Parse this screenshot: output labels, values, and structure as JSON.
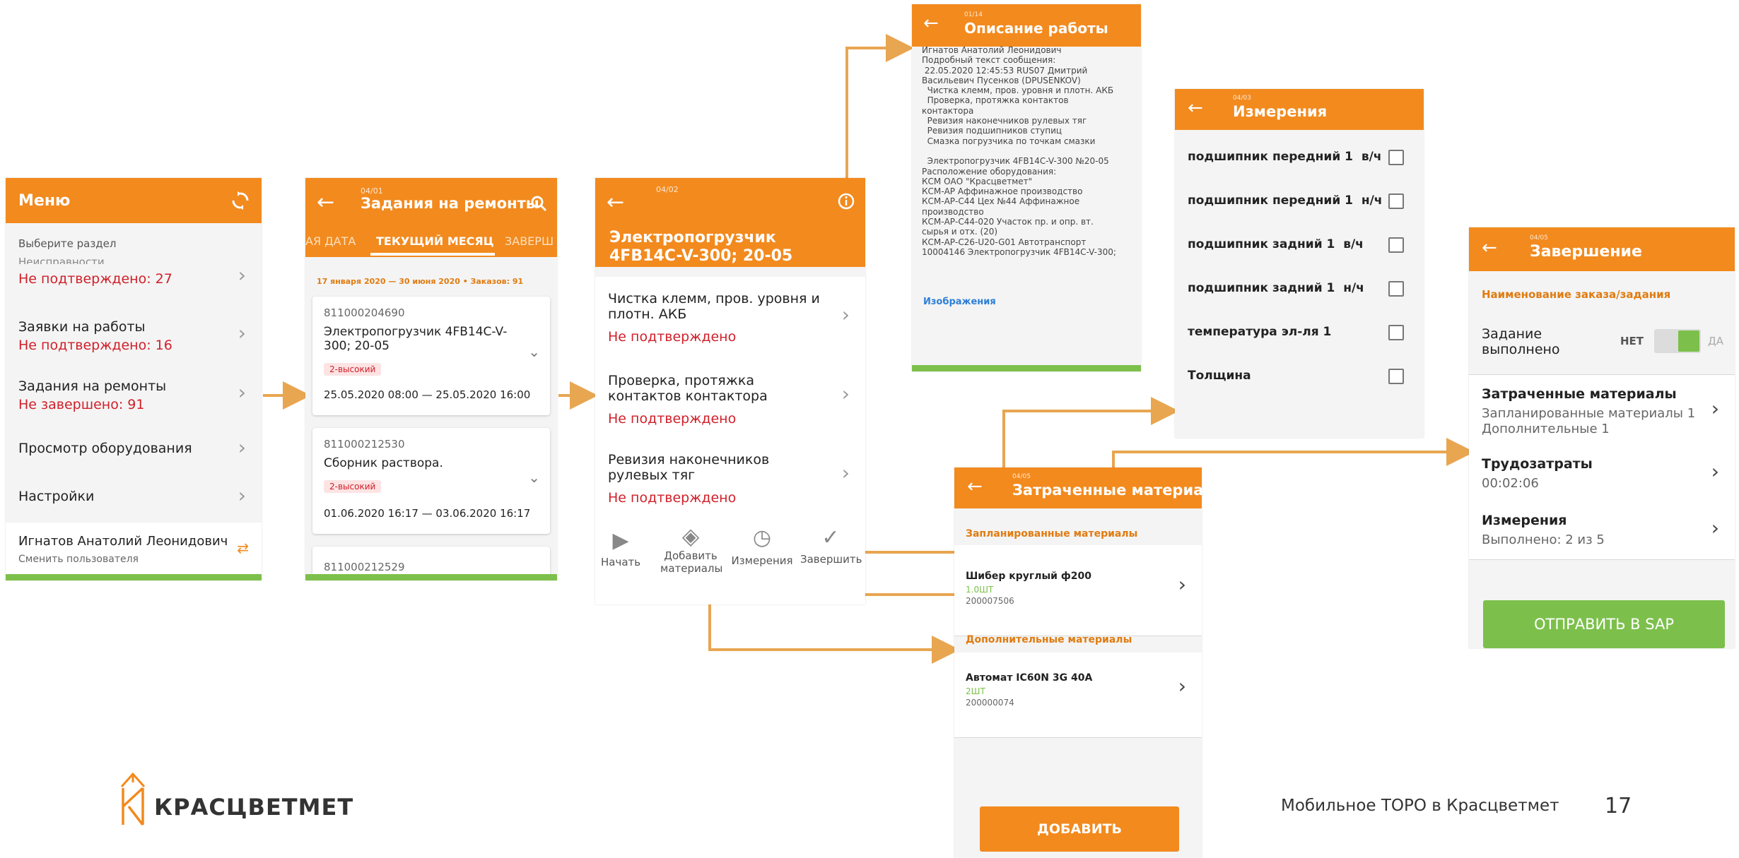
{
  "menu": {
    "title": "Меню",
    "section_label": "Выберите раздел",
    "items": [
      {
        "label": "Неисправности",
        "status": "Не подтверждено: 27"
      },
      {
        "label": "Заявки на работы",
        "status": "Не подтверждено: 16"
      },
      {
        "label": "Задания на ремонты",
        "status": "Не завершено: 91"
      },
      {
        "label": "Просмотр оборудования",
        "status": ""
      },
      {
        "label": "Настройки",
        "status": ""
      }
    ],
    "user_name": "Игнатов Анатолий Леонидович",
    "user_action": "Сменить пользователя"
  },
  "tasks": {
    "step": "04/01",
    "title": "Задания на ремонты",
    "tabs": [
      "АЯ ДАТА",
      "ТЕКУЩИЙ МЕСЯЦ",
      "ЗАВЕРШ"
    ],
    "range": "17 января 2020 — 30 июня 2020 • Заказов: 91",
    "cards": [
      {
        "id": "811000204690",
        "name": "Электропогрузчик 4FB14C-V-300; 20-05",
        "priority": "2-высокий",
        "dates": "25.05.2020 08:00 — 25.05.2020 16:00"
      },
      {
        "id": "811000212530",
        "name": "Сборник раствора.",
        "priority": "2-высокий",
        "dates": "01.06.2020 16:17 — 03.06.2020 16:17"
      },
      {
        "id": "811000212529",
        "name": "",
        "priority": "",
        "dates": ""
      }
    ]
  },
  "equipment": {
    "step": "04/02",
    "title": "Электропогрузчик 4FB14C-V-300; 20-05",
    "ops": [
      {
        "name": "Чистка клемм, пров. уровня и плотн. АКБ",
        "status": "Не подтверждено"
      },
      {
        "name": "Проверка, протяжка контактов контактора",
        "status": "Не подтверждено"
      },
      {
        "name": "Ревизия наконечников рулевых тяг",
        "status": "Не подтверждено"
      }
    ],
    "actions": [
      "Начать",
      "Добавить материалы",
      "Измерения",
      "Завершить"
    ]
  },
  "description": {
    "step": "01/14",
    "title": "Описание работы",
    "lines": [
      "Игнатов Анатолий Леонидович",
      "Подробный текст сообщения:",
      " 22.05.2020 12:45:53 RUS07 Дмитрий",
      "Васильевич Пусенков (DPUSENKOV)",
      "  Чистка клемм, пров. уровня и плотн. АКБ",
      "  Проверка, протяжка контактов",
      "контактора",
      "  Ревизия наконечников рулевых тяг",
      "  Ревизия подшипников ступиц",
      "  Смазка погрузчика по точкам смазки",
      "",
      "  Электропогрузчик 4FB14C-V-300 №20-05",
      "Расположение оборудования:",
      "КСМ ОАО \"Красцветмет\"",
      "КСМ-АР Аффинажное производство",
      "КСМ-АР-С44 Цех №44 Аффинажное",
      "производство",
      "КСМ-АР-С44-020 Участок пр. и опр. вт.",
      "сырья и отх. (20)",
      "КСМ-АР-С26-U20-G01 Автотранспорт",
      "10004146 Электропогрузчик 4FB14C-V-300;"
    ],
    "link": "Изображения"
  },
  "measurements": {
    "step": "04/03",
    "title": "Измерения",
    "items": [
      "подшипник передний 1  в/ч",
      "подшипник передний 1  н/ч",
      "подшипник задний 1  в/ч",
      "подшипник задний 1  н/ч",
      "температура эл-ля 1",
      "Толщина"
    ]
  },
  "materials": {
    "step": "04/05",
    "title": "Затраченные материалы",
    "planned_header": "Запланированные материалы",
    "planned": [
      {
        "name": "Шибер круглый ф200",
        "qty": "1.0ШТ",
        "code": "200007506"
      }
    ],
    "extra_header": "Дополнительные материалы",
    "extra": [
      {
        "name": "Автомат IC60N 3G 40A",
        "qty": "2ШТ",
        "code": "200000074"
      }
    ],
    "add_button": "ДОБАВИТЬ"
  },
  "completion": {
    "step": "04/05",
    "title": "Завершение",
    "order_header": "Наименование заказа/задания",
    "done_label": "Задание выполнено",
    "toggle_no": "НЕТ",
    "toggle_yes": "ДА",
    "rows": [
      {
        "title": "Затраченные материалы",
        "sub": "Запланированные материалы 1\nДополнительные 1"
      },
      {
        "title": "Трудозатраты",
        "sub": "00:02:06"
      },
      {
        "title": "Измерения",
        "sub": "Выполнено:  2 из 5"
      }
    ],
    "send_button": "ОТПРАВИТЬ В SAP"
  },
  "footer": {
    "brand": "КРАСЦВЕТМЕТ",
    "caption": "Мобильное ТОРО в Красцветмет",
    "page": "17"
  },
  "colors": {
    "accent": "#f28a1e",
    "status_red": "#d0202a",
    "green": "#7cc04b",
    "connector": "#e8a651"
  }
}
